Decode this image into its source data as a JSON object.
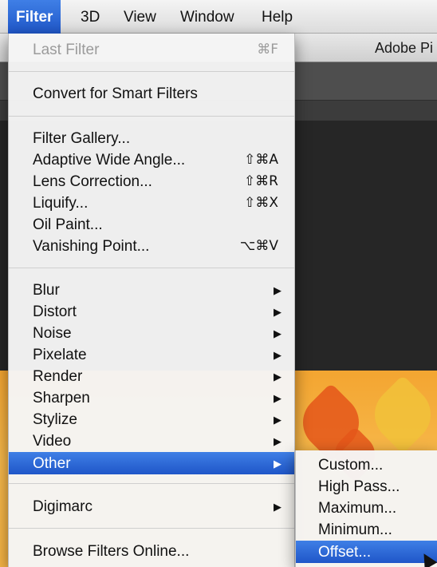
{
  "menubar": {
    "items": [
      {
        "label": "Filter",
        "active": true
      },
      {
        "label": "3D"
      },
      {
        "label": "View"
      },
      {
        "label": "Window"
      },
      {
        "label": "Help"
      }
    ]
  },
  "app": {
    "title": "Adobe Pi"
  },
  "filter_menu": {
    "last_filter": {
      "label": "Last Filter",
      "shortcut": "⌘F",
      "enabled": false
    },
    "convert_smart": {
      "label": "Convert for Smart Filters"
    },
    "filter_gallery": {
      "label": "Filter Gallery..."
    },
    "adaptive_wide_angle": {
      "label": "Adaptive Wide Angle...",
      "shortcut": "⇧⌘A"
    },
    "lens_correction": {
      "label": "Lens Correction...",
      "shortcut": "⇧⌘R"
    },
    "liquify": {
      "label": "Liquify...",
      "shortcut": "⇧⌘X"
    },
    "oil_paint": {
      "label": "Oil Paint..."
    },
    "vanishing_point": {
      "label": "Vanishing Point...",
      "shortcut": "⌥⌘V"
    },
    "submenus": [
      {
        "label": "Blur"
      },
      {
        "label": "Distort"
      },
      {
        "label": "Noise"
      },
      {
        "label": "Pixelate"
      },
      {
        "label": "Render"
      },
      {
        "label": "Sharpen"
      },
      {
        "label": "Stylize"
      },
      {
        "label": "Video"
      },
      {
        "label": "Other",
        "highlighted": true
      }
    ],
    "digimarc": {
      "label": "Digimarc"
    },
    "browse_online": {
      "label": "Browse Filters Online..."
    },
    "submenu_arrow": "▶"
  },
  "other_submenu": {
    "items": [
      {
        "label": "Custom..."
      },
      {
        "label": "High Pass..."
      },
      {
        "label": "Maximum..."
      },
      {
        "label": "Minimum..."
      },
      {
        "label": "Offset...",
        "highlighted": true
      }
    ]
  },
  "colors": {
    "highlight": "#2f6ad8",
    "menu_bg": "#f5f5f5",
    "disabled_text": "#9b9b9b"
  }
}
